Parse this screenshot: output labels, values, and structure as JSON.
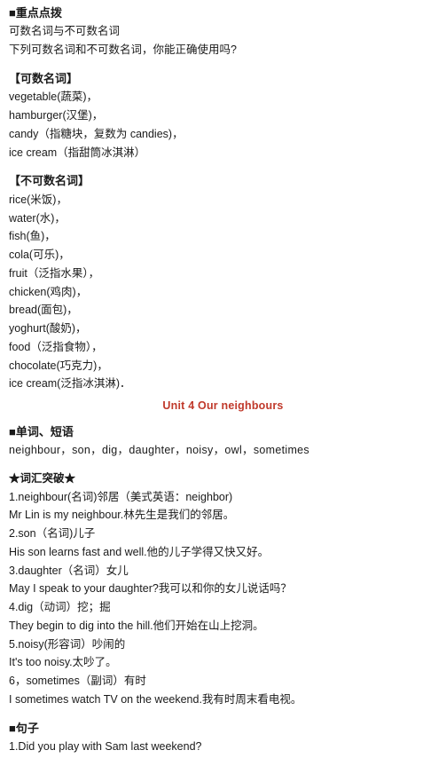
{
  "document": {
    "sections": [
      {
        "id": "key-points",
        "heading": "■重点点拨",
        "lines": [
          "可数名词与不可数名词",
          "下列可数名词和不可数名词，你能正确使用吗?"
        ]
      },
      {
        "id": "countable",
        "heading": "【可数名词】",
        "lines": [
          "vegetable(蔬菜)，",
          "hamburger(汉堡)，",
          "candy（指糖块，复数为 candies)，",
          "ice cream（指甜筒冰淇淋）"
        ]
      },
      {
        "id": "uncountable",
        "heading": "【不可数名词】",
        "lines": [
          "rice(米饭)，",
          "water(水)，",
          "fish(鱼)，",
          "cola(可乐)，",
          "fruit（泛指水果）， ",
          "chicken(鸡肉)，",
          "bread(面包)，",
          "yoghurt(酸奶)，",
          "food（泛指食物），",
          "chocolate(巧克力)，",
          "ice cream(泛指冰淇淋)．"
        ]
      }
    ],
    "unit_title": "Unit 4 Our neighbours",
    "words_section": {
      "heading": "■单词、短语",
      "lines": [
        "neighbour，son，dig，daughter，noisy，owl，sometimes"
      ]
    },
    "vocab_section": {
      "heading": "★词汇突破★",
      "entries": [
        {
          "term": "1.neighbour(名词)邻居（美式英语：neighbor)",
          "example": "Mr Lin is my neighbour.林先生是我们的邻居。"
        },
        {
          "term": "2.son（名词)儿子",
          "example": "His son learns fast and well.他的儿子学得又快又好。"
        },
        {
          "term": "3.daughter（名词）女儿",
          "example": "May I speak to your daughter?我可以和你的女儿说话吗？"
        },
        {
          "term": "4.dig（动词）挖；掘",
          "example": "They begin to dig into the hill.他们开始在山上挖洞。"
        },
        {
          "term": "5.noisy(形容词）吵闹的",
          "example": "It's too noisy.太吵了。"
        },
        {
          "term": "6，sometimes（副词）有时",
          "example": "I sometimes watch TV on the weekend.我有时周末看电视。"
        }
      ]
    },
    "sentence_section": {
      "heading": "■句子",
      "lines": [
        "1.Did you play with Sam last weekend?"
      ]
    }
  }
}
